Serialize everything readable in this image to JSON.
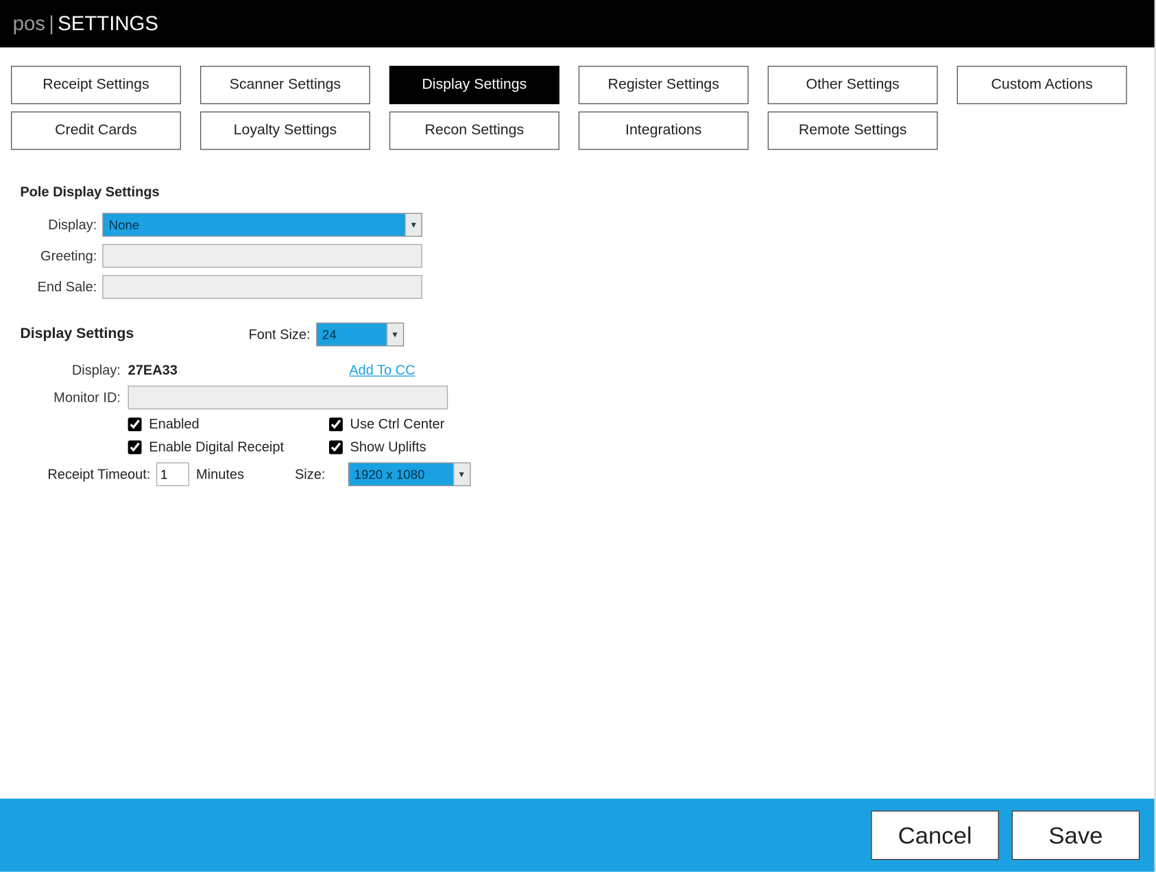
{
  "header": {
    "app": "pos",
    "separator": "|",
    "title": "SETTINGS"
  },
  "tabs": {
    "row1": [
      {
        "label": "Receipt Settings",
        "active": false
      },
      {
        "label": "Scanner Settings",
        "active": false
      },
      {
        "label": "Display Settings",
        "active": true
      },
      {
        "label": "Register Settings",
        "active": false
      },
      {
        "label": "Other Settings",
        "active": false
      },
      {
        "label": "Custom Actions",
        "active": false
      }
    ],
    "row2": [
      {
        "label": "Credit Cards",
        "active": false
      },
      {
        "label": "Loyalty Settings",
        "active": false
      },
      {
        "label": "Recon Settings",
        "active": false
      },
      {
        "label": "Integrations",
        "active": false
      },
      {
        "label": "Remote Settings",
        "active": false
      }
    ]
  },
  "pole": {
    "section_title": "Pole Display Settings",
    "display_label": "Display:",
    "display_value": "None",
    "greeting_label": "Greeting:",
    "greeting_value": "",
    "endsale_label": "End Sale:",
    "endsale_value": ""
  },
  "display": {
    "section_title": "Display Settings",
    "fontsize_label": "Font Size:",
    "fontsize_value": "24",
    "display_label": "Display:",
    "display_value": "27EA33",
    "add_to_cc": "Add To CC",
    "monitor_label": "Monitor ID:",
    "monitor_value": "",
    "enabled_label": "Enabled",
    "enabled_checked": true,
    "use_ctrl_center_label": "Use Ctrl Center",
    "use_ctrl_center_checked": true,
    "enable_digital_receipt_label": "Enable Digital Receipt",
    "enable_digital_receipt_checked": true,
    "show_uplifts_label": "Show Uplifts",
    "show_uplifts_checked": true,
    "receipt_timeout_label": "Receipt Timeout:",
    "receipt_timeout_value": "1",
    "receipt_timeout_unit": "Minutes",
    "size_label": "Size:",
    "size_value": "1920 x 1080"
  },
  "footer": {
    "cancel": "Cancel",
    "save": "Save"
  }
}
